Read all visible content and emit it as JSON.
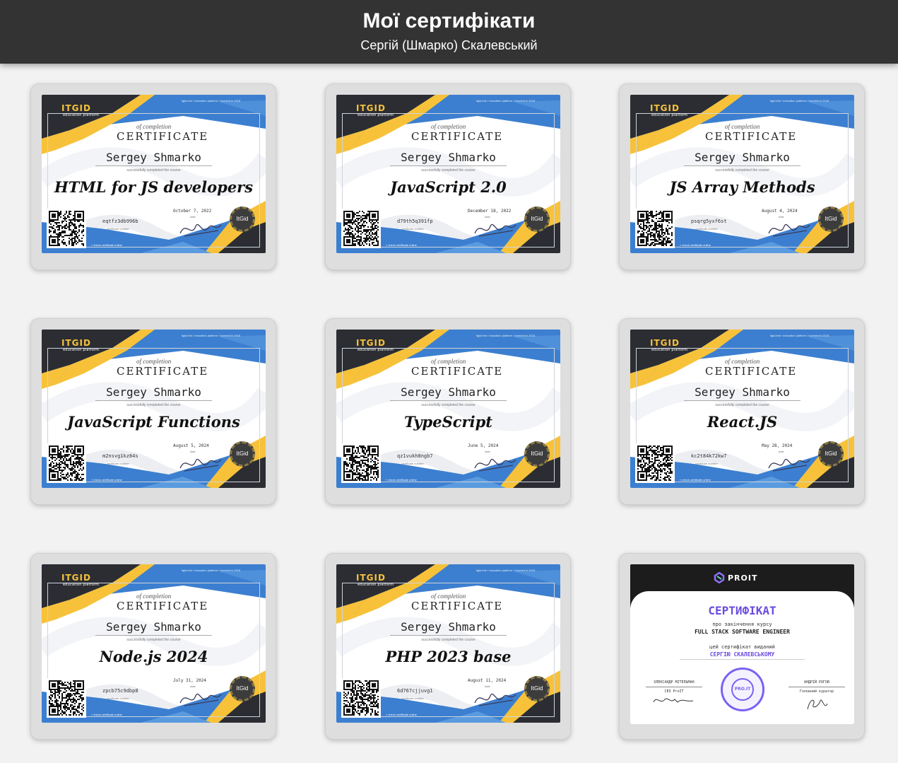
{
  "header": {
    "title": "Мої сертифікати",
    "subtitle": "Сергій (Шмарко) Скалевський"
  },
  "itgid": {
    "logo": "ITGID",
    "logo_sub": "education platform",
    "top_line": "itgid.info / education platform / founded in 2018",
    "of_completion": "of completion",
    "cert_title": "CERTIFICATE",
    "name": "Sergey Shmarko",
    "completed": "successfully completed the course",
    "date_label": "date",
    "number_label": "certificate number",
    "check_label": "« check certificate online",
    "seal_text": "ItGid"
  },
  "certificates": [
    {
      "course": "HTML for JS developers",
      "date": "October 7, 2022",
      "number": "eqtfz3db996b"
    },
    {
      "course": "JavaScript 2.0",
      "date": "December 18, 2022",
      "number": "d79th5q391fp"
    },
    {
      "course": "JS Array Methods",
      "date": "August 4, 2024",
      "number": "psqrg5yxf6st"
    },
    {
      "course": "JavaScript Functions",
      "date": "August 5, 2024",
      "number": "m2nsvg1kz84s"
    },
    {
      "course": "TypeScript",
      "date": "June 5, 2024",
      "number": "qz1vukh8ngb7"
    },
    {
      "course": "React.JS",
      "date": "May 28, 2024",
      "number": "kc2t84k72kw7"
    },
    {
      "course": "Node.js 2024",
      "date": "July 31, 2024",
      "number": "zpcb75c9dbp8"
    },
    {
      "course": "PHP  2023 base",
      "date": "August 11, 2024",
      "number": "6d767cjjuvg1"
    }
  ],
  "proit": {
    "logo": "PROIT",
    "title": "СЕРТИФІКАТ",
    "subtitle": "про закінчення курсу",
    "course": "FULL STACK SOFTWARE ENGINEER",
    "issued": "цей сертифікат виданий",
    "recipient": "СЕРГІЮ СКАЛЕВСЬКОМУ",
    "signer1_name": "ОЛЕКСАНДР МІТЕЛЬМАН",
    "signer1_role": "CEO ProIT",
    "signer2_name": "АНДРІЙ РОГОВ",
    "signer2_role": "Головний куратор",
    "seal_text": "PRO.IT"
  },
  "colors": {
    "header_bg": "#333333",
    "page_bg": "#f2f2f2",
    "itgid_blue": "#3c7fd0",
    "itgid_yellow": "#f7c23a",
    "itgid_dark": "#2b2d33",
    "proit_purple": "#6b4ce0"
  }
}
